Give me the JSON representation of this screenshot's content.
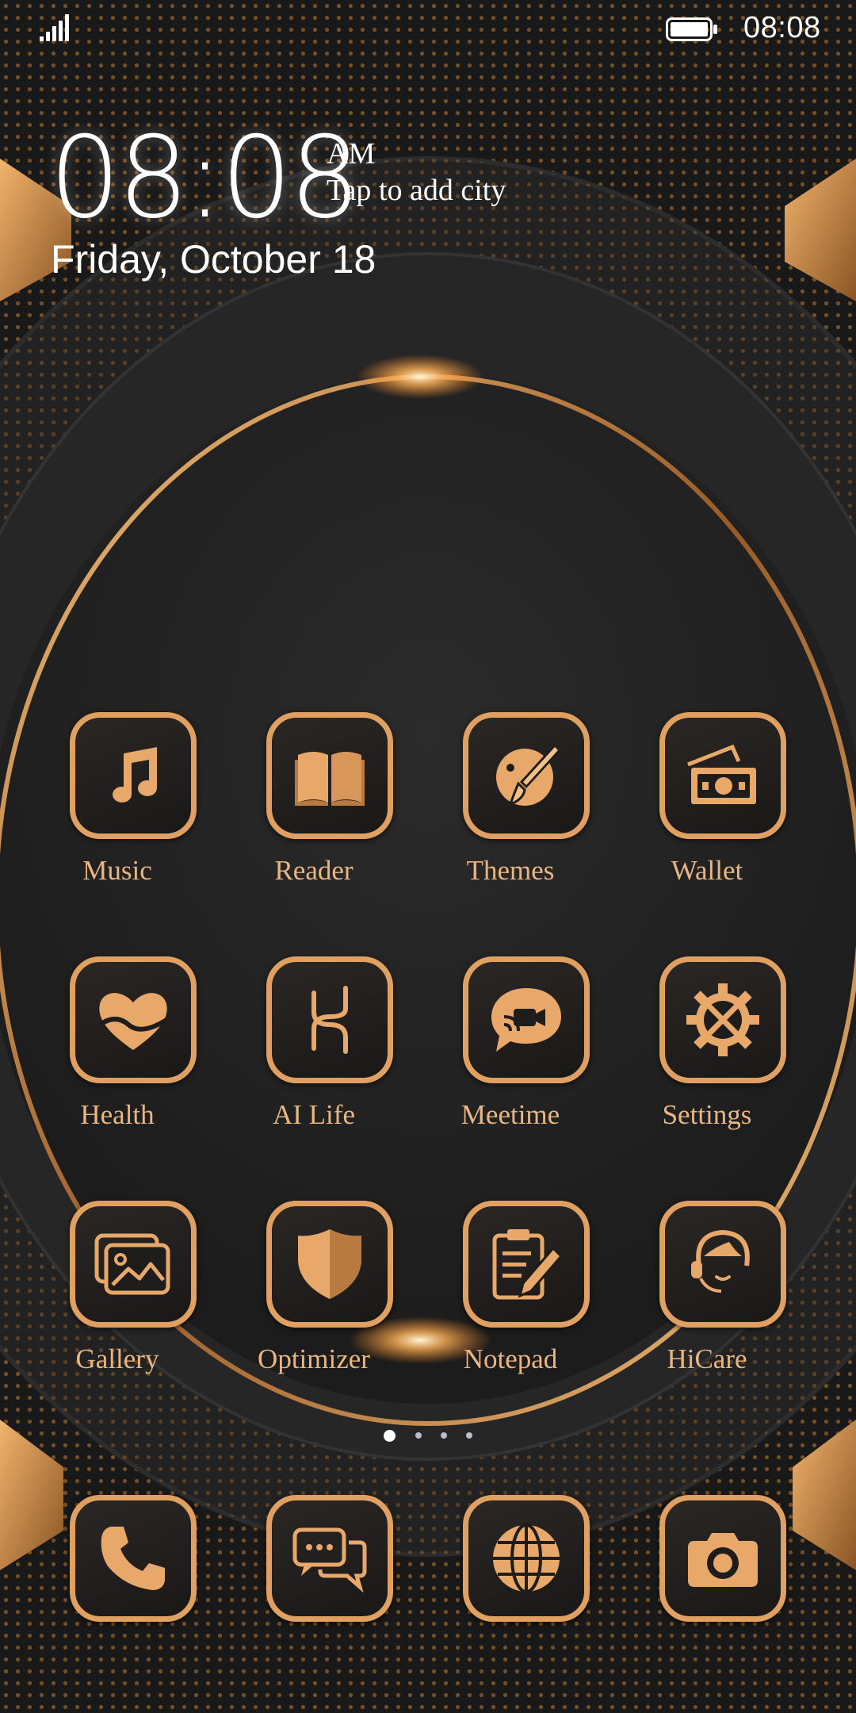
{
  "status_bar": {
    "time": "08:08",
    "signal_icon": "signal-bars-icon",
    "battery_icon": "battery-icon"
  },
  "clock_widget": {
    "time": "08:08",
    "ampm": "AM",
    "city_prompt": "Tap to add city",
    "date": "Friday, October 18"
  },
  "apps": [
    {
      "label": "Music",
      "icon": "music-note-icon"
    },
    {
      "label": "Reader",
      "icon": "book-icon"
    },
    {
      "label": "Themes",
      "icon": "paintbrush-palette-icon"
    },
    {
      "label": "Wallet",
      "icon": "wallet-cash-icon"
    },
    {
      "label": "Health",
      "icon": "heart-icon"
    },
    {
      "label": "AI Life",
      "icon": "ai-life-icon"
    },
    {
      "label": "Meetime",
      "icon": "video-chat-icon"
    },
    {
      "label": "Settings",
      "icon": "gear-tools-icon"
    },
    {
      "label": "Gallery",
      "icon": "photo-icon"
    },
    {
      "label": "Optimizer",
      "icon": "shield-icon"
    },
    {
      "label": "Notepad",
      "icon": "clipboard-pencil-icon"
    },
    {
      "label": "HiCare",
      "icon": "headset-person-icon"
    }
  ],
  "page_indicator": {
    "total": 4,
    "current": 1
  },
  "dock": [
    {
      "icon": "phone-icon"
    },
    {
      "icon": "messages-icon"
    },
    {
      "icon": "globe-icon"
    },
    {
      "icon": "camera-icon"
    }
  ],
  "colors": {
    "accent_gold": "#e0a062",
    "label_gold": "#e8b583",
    "background": "#1b1b1b",
    "text_white": "#ffffff"
  }
}
